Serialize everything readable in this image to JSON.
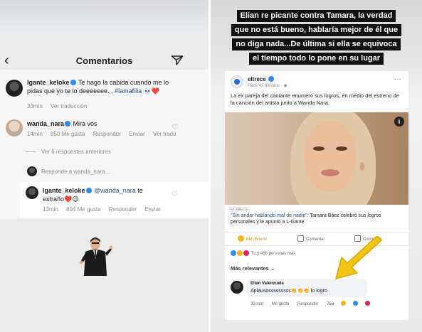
{
  "left_story": {
    "header": {
      "back_label": "‹",
      "title": "Comentarios",
      "send_icon": "paper-plane-icon"
    },
    "comments": [
      {
        "username": "lgante_keloke",
        "text_plain": "Te hago la cabida cuando me lo pidas que yo te lo deeeeeee... ",
        "hashtag": "#lamafilia",
        "emoji": "💀❤️",
        "time": "33min",
        "translate": "Ver traducción"
      },
      {
        "username": "wanda_nara",
        "text": "Mira vos",
        "time": "14min",
        "likes": "850 Me gusta",
        "reply": "Responder",
        "send": "Enviar",
        "translate": "Ver tradu"
      }
    ],
    "view_replies": "Ver 6 respuestas anteriores",
    "reply_to": "Responde a wanda_nara...",
    "reply": {
      "username": "lgante_keloke",
      "mention": "@wanda_nara",
      "text": "te",
      "text2": "extraño❤️😔",
      "time": "13min",
      "likes": "804 Me gusta",
      "reply": "Responder",
      "send": "Enviar"
    }
  },
  "right_story": {
    "caption_lines": [
      "Elian re picante contra Tamara, la verdad",
      "que no está bueno, hablaría mejor de él que",
      "no diga nada...De última si ella se equivoca",
      "el tiempo todo lo pone en su lugar"
    ],
    "post": {
      "page_name": "eltrece",
      "time": "Hace 42 minutos ·",
      "text": "La ex pareja del cantante enumeró sus logros, en medio del estreno de la canción del artista junto a Wanda Nara.",
      "source": "ELTRECE",
      "headline_link": "\"Sin andar hablando mal de nadie\": ",
      "headline_rest": "Tamara Báez celebró sus logros personales y le apuntó a L-Gante",
      "actions": {
        "like": "Me divierte",
        "comment": "Comentar",
        "share": "Compartir"
      },
      "reactions_text": "Tú y 458 personas más",
      "sort_label": "Más relevantes ⌄",
      "comment": {
        "name": "Elian Valenzuela",
        "text": "Aplausosssssssss👏👏👏 lo logro",
        "time": "39 min",
        "like": "Me gusta",
        "reply": "Responder",
        "count": "756"
      }
    }
  },
  "colors": {
    "verified": "#2e8df5",
    "heart": "#e0245e",
    "caption_bg": "#111111",
    "arrow": "#f2c418"
  }
}
